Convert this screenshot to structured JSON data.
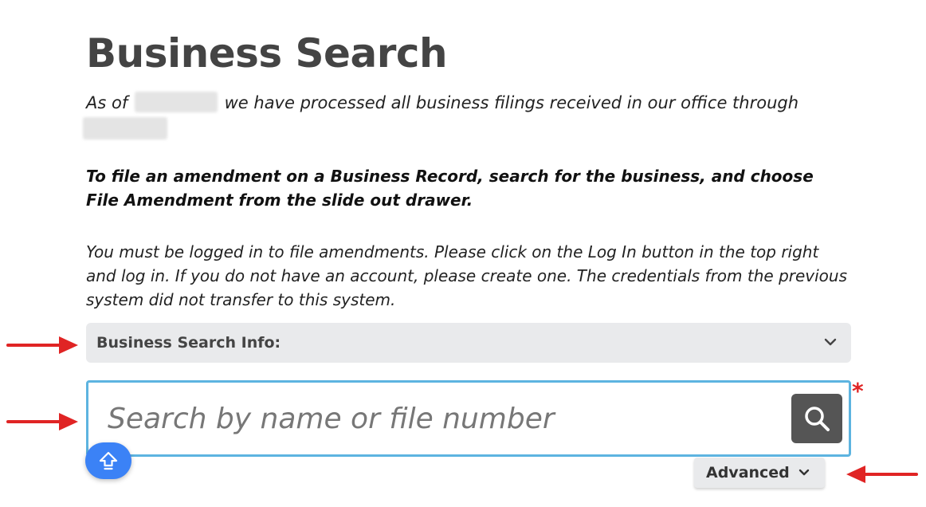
{
  "page": {
    "title": "Business Search",
    "processed_prefix": "As of",
    "processed_middle": "we have processed all business filings received in our office through",
    "amendment_note": "To file an amendment on a Business Record, search for the business, and choose File Amendment from the slide out drawer.",
    "login_note": "You must be logged in to file amendments. Please click on the Log In button in the top right and log in. If you do not have an account, please create one. The credentials from the previous system did not transfer to this system."
  },
  "search_info": {
    "label": "Business Search Info:",
    "icon": "chevron-down-icon"
  },
  "search": {
    "placeholder": "Search by name or file number",
    "value": "",
    "required_mark": "*",
    "button_icon": "magnifier-icon"
  },
  "advanced": {
    "label": "Advanced",
    "icon": "chevron-down-icon"
  },
  "scroll_top": {
    "icon": "arrow-up-icon"
  },
  "colors": {
    "accent_blue": "#3b82f6",
    "search_border": "#5db4e0",
    "annotation_red": "#e02424",
    "search_button": "#555555"
  }
}
